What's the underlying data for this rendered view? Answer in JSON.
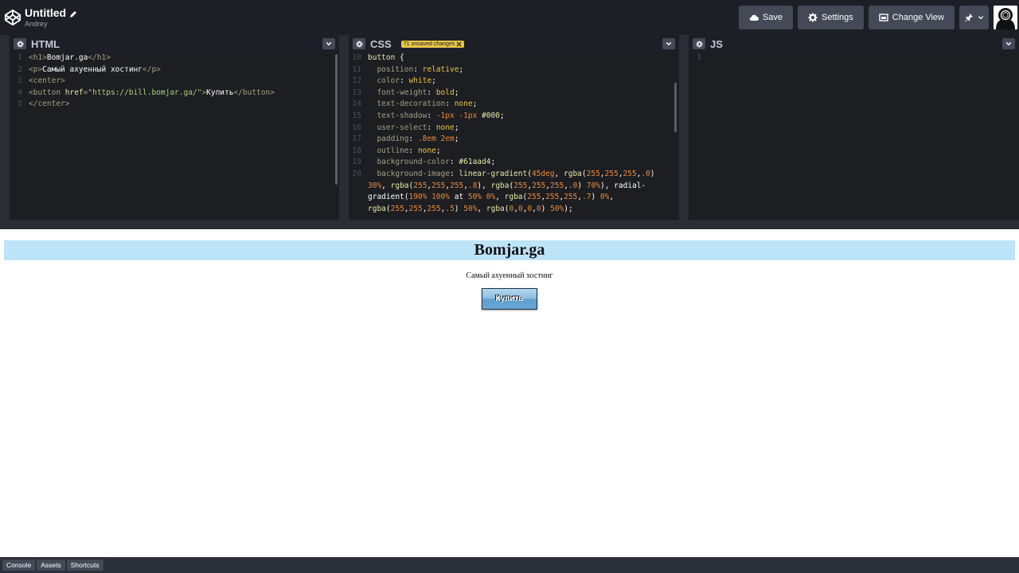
{
  "header": {
    "title": "Untitled",
    "author": "Andrey",
    "buttons": {
      "save": "Save",
      "settings": "Settings",
      "change_view": "Change View"
    }
  },
  "panes": {
    "html": {
      "name": "HTML",
      "lines": [
        {
          "n": "1",
          "parts": [
            [
              "t-tag",
              "<h1>"
            ],
            [
              "t-txt",
              "Bomjar.ga"
            ],
            [
              "t-tag",
              "</h1>"
            ]
          ]
        },
        {
          "n": "2",
          "parts": [
            [
              "t-tag",
              "<p>"
            ],
            [
              "t-txt",
              "Самый ахуенный хостинг"
            ],
            [
              "t-tag",
              "</p>"
            ]
          ]
        },
        {
          "n": "3",
          "parts": [
            [
              "t-tag",
              "<center>"
            ]
          ]
        },
        {
          "n": "4",
          "parts": [
            [
              "t-tag",
              "<button "
            ],
            [
              "t-attr",
              "href"
            ],
            [
              "t-tag",
              "="
            ],
            [
              "t-str",
              "\"https://bill.bomjar.ga/\""
            ],
            [
              "t-tag",
              ">"
            ],
            [
              "t-txt",
              "Купить"
            ],
            [
              "t-tag",
              "</button>"
            ]
          ]
        },
        {
          "n": "5",
          "parts": [
            [
              "t-tag",
              "</center>"
            ]
          ]
        }
      ]
    },
    "css": {
      "name": "CSS",
      "badge": "71 unsaved changes",
      "lines": [
        {
          "n": "10",
          "parts": [
            [
              "t-sel",
              "button "
            ],
            [
              "t-txt",
              "{"
            ]
          ]
        },
        {
          "n": "11",
          "parts": [
            [
              "t-prop",
              "  position"
            ],
            [
              "t-txt",
              ": "
            ],
            [
              "t-val",
              "relative"
            ],
            [
              "t-txt",
              ";"
            ]
          ]
        },
        {
          "n": "12",
          "parts": [
            [
              "t-prop",
              "  color"
            ],
            [
              "t-txt",
              ": "
            ],
            [
              "t-val",
              "white"
            ],
            [
              "t-txt",
              ";"
            ]
          ]
        },
        {
          "n": "13",
          "parts": [
            [
              "t-prop",
              "  font-weight"
            ],
            [
              "t-txt",
              ": "
            ],
            [
              "t-val",
              "bold"
            ],
            [
              "t-txt",
              ";"
            ]
          ]
        },
        {
          "n": "14",
          "parts": [
            [
              "t-prop",
              "  text-decoration"
            ],
            [
              "t-txt",
              ": "
            ],
            [
              "t-val",
              "none"
            ],
            [
              "t-txt",
              ";"
            ]
          ]
        },
        {
          "n": "15",
          "parts": [
            [
              "t-prop",
              "  text-shadow"
            ],
            [
              "t-txt",
              ": "
            ],
            [
              "t-num",
              "-1px -1px "
            ],
            [
              "t-hex",
              "#000"
            ],
            [
              "t-txt",
              ";"
            ]
          ]
        },
        {
          "n": "16",
          "parts": [
            [
              "t-prop",
              "  user-select"
            ],
            [
              "t-txt",
              ": "
            ],
            [
              "t-val",
              "none"
            ],
            [
              "t-txt",
              ";"
            ]
          ]
        },
        {
          "n": "17",
          "parts": [
            [
              "t-prop",
              "  padding"
            ],
            [
              "t-txt",
              ": "
            ],
            [
              "t-num",
              ".8em 2em"
            ],
            [
              "t-txt",
              ";"
            ]
          ]
        },
        {
          "n": "18",
          "parts": [
            [
              "t-prop",
              "  outline"
            ],
            [
              "t-txt",
              ": "
            ],
            [
              "t-val",
              "none"
            ],
            [
              "t-txt",
              ";"
            ]
          ]
        },
        {
          "n": "19",
          "parts": [
            [
              "t-prop",
              "  background-color"
            ],
            [
              "t-txt",
              ": "
            ],
            [
              "t-hex",
              "#61aad4"
            ],
            [
              "t-txt",
              ";"
            ]
          ]
        },
        {
          "n": "20",
          "parts": [
            [
              "t-prop",
              "  background-image"
            ],
            [
              "t-txt",
              ": "
            ],
            [
              "t-fn",
              "linear-gradient"
            ],
            [
              "t-txt",
              "("
            ],
            [
              "t-num",
              "45deg"
            ],
            [
              "t-txt",
              ", "
            ],
            [
              "t-fn",
              "rgba"
            ],
            [
              "t-txt",
              "("
            ],
            [
              "t-num",
              "255"
            ],
            [
              "t-txt",
              ","
            ],
            [
              "t-num",
              "255"
            ],
            [
              "t-txt",
              ","
            ],
            [
              "t-num",
              "255"
            ],
            [
              "t-txt",
              ","
            ],
            [
              "t-num",
              ".0"
            ],
            [
              "t-txt",
              ")"
            ]
          ]
        },
        {
          "n": "",
          "parts": [
            [
              "t-num",
              "30%"
            ],
            [
              "t-txt",
              ", "
            ],
            [
              "t-fn",
              "rgba"
            ],
            [
              "t-txt",
              "("
            ],
            [
              "t-num",
              "255"
            ],
            [
              "t-txt",
              ","
            ],
            [
              "t-num",
              "255"
            ],
            [
              "t-txt",
              ","
            ],
            [
              "t-num",
              "255"
            ],
            [
              "t-txt",
              ","
            ],
            [
              "t-num",
              ".8"
            ],
            [
              "t-txt",
              "), "
            ],
            [
              "t-fn",
              "rgba"
            ],
            [
              "t-txt",
              "("
            ],
            [
              "t-num",
              "255"
            ],
            [
              "t-txt",
              ","
            ],
            [
              "t-num",
              "255"
            ],
            [
              "t-txt",
              ","
            ],
            [
              "t-num",
              "255"
            ],
            [
              "t-txt",
              ","
            ],
            [
              "t-num",
              ".0"
            ],
            [
              "t-txt",
              ") "
            ],
            [
              "t-num",
              "70%"
            ],
            [
              "t-txt",
              "), radial-"
            ]
          ]
        },
        {
          "n": "",
          "parts": [
            [
              "t-txt",
              "gradient("
            ],
            [
              "t-num",
              "190% 100%"
            ],
            [
              "t-txt",
              " at "
            ],
            [
              "t-num",
              "50% 0%"
            ],
            [
              "t-txt",
              ", "
            ],
            [
              "t-fn",
              "rgba"
            ],
            [
              "t-txt",
              "("
            ],
            [
              "t-num",
              "255"
            ],
            [
              "t-txt",
              ","
            ],
            [
              "t-num",
              "255"
            ],
            [
              "t-txt",
              ","
            ],
            [
              "t-num",
              "255"
            ],
            [
              "t-txt",
              ","
            ],
            [
              "t-num",
              ".7"
            ],
            [
              "t-txt",
              ") "
            ],
            [
              "t-num",
              "0%"
            ],
            [
              "t-txt",
              ","
            ]
          ]
        },
        {
          "n": "",
          "parts": [
            [
              "t-fn",
              "rgba"
            ],
            [
              "t-txt",
              "("
            ],
            [
              "t-num",
              "255"
            ],
            [
              "t-txt",
              ","
            ],
            [
              "t-num",
              "255"
            ],
            [
              "t-txt",
              ","
            ],
            [
              "t-num",
              "255"
            ],
            [
              "t-txt",
              ","
            ],
            [
              "t-num",
              ".5"
            ],
            [
              "t-txt",
              ") "
            ],
            [
              "t-num",
              "50%"
            ],
            [
              "t-txt",
              ", "
            ],
            [
              "t-fn",
              "rgba"
            ],
            [
              "t-txt",
              "("
            ],
            [
              "t-num",
              "0"
            ],
            [
              "t-txt",
              ","
            ],
            [
              "t-num",
              "0"
            ],
            [
              "t-txt",
              ","
            ],
            [
              "t-num",
              "0"
            ],
            [
              "t-txt",
              ","
            ],
            [
              "t-num",
              "0"
            ],
            [
              "t-txt",
              ") "
            ],
            [
              "t-num",
              "50%"
            ],
            [
              "t-txt",
              ");"
            ]
          ]
        }
      ]
    },
    "js": {
      "name": "JS",
      "lines": [
        {
          "n": "1",
          "parts": []
        }
      ]
    }
  },
  "preview": {
    "h1": "Bomjar.ga",
    "p": "Самый ахуенный хостинг",
    "button": "Купить"
  },
  "footer": {
    "console": "Console",
    "assets": "Assets",
    "shortcuts": "Shortcuts"
  }
}
